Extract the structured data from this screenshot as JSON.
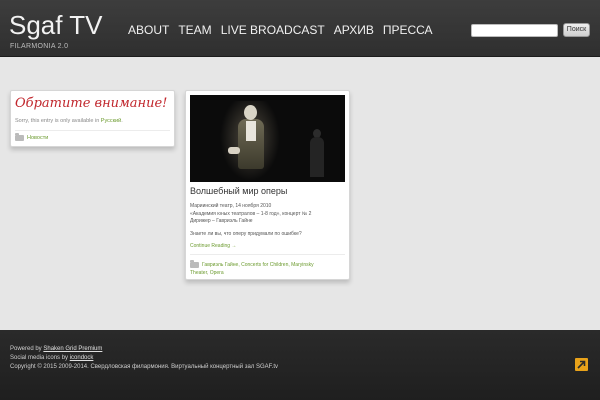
{
  "header": {
    "site_title": "Sgaf TV",
    "site_subtitle": "FILARMONIA 2.0",
    "nav": [
      "ABOUT",
      "TEAM",
      "LIVE BROADCAST",
      "АРХИВ",
      "ПРЕССА"
    ],
    "search_placeholder": "",
    "search_button": "Поиск"
  },
  "notice_card": {
    "title": "Обратите внимание!",
    "text_before": "Sorry, this entry is only available in ",
    "text_link": "Русский",
    "text_after": ".",
    "category": "Новости"
  },
  "post_card": {
    "title": "Волшебный мир оперы",
    "meta": [
      "Мариинский театр, 14 ноября 2010",
      "«Академия юных театралов – 1-8 год», концерт № 2",
      "Дирижер – Гавриэль Гайне"
    ],
    "question": "Знаете ли вы, что оперу придумали по ошибке?",
    "continue": "Continue Reading →",
    "tags_line1": "Гавриэль Гайне, Concerts for Children, Maryinsky",
    "tags_line2": "Theater, Opera"
  },
  "footer": {
    "powered_prefix": "Powered by ",
    "powered_link": "Shaken Grid Premium",
    "icons_prefix": "Social media icons by ",
    "icons_link": "icondock",
    "copyright": "Copyright © 2015 2009-2014. Свердловская филармония. Виртуальный концертный зал SGAF.tv"
  },
  "colors": {
    "accent_green": "#6c9b2f",
    "notice_red": "#c1272d",
    "top_button": "#e8a21a"
  }
}
